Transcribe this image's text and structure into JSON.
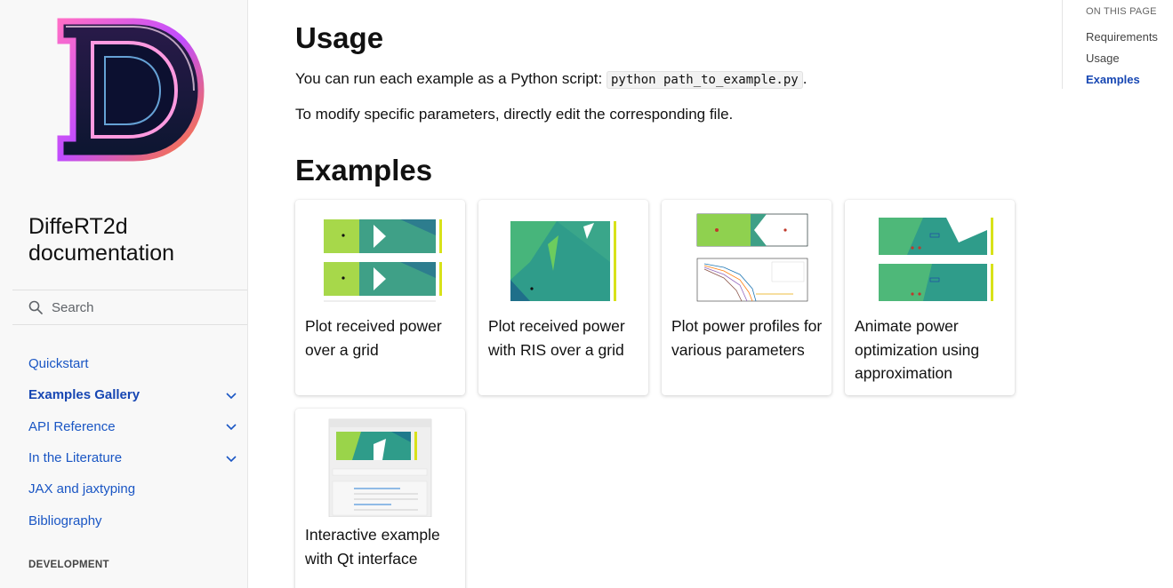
{
  "sidebar": {
    "title": "DiffeRT2d documentation",
    "search_placeholder": "Search",
    "items": [
      {
        "label": "Quickstart"
      },
      {
        "label": "Examples Gallery"
      },
      {
        "label": "API Reference"
      },
      {
        "label": "In the Literature"
      },
      {
        "label": "JAX and jaxtyping"
      },
      {
        "label": "Bibliography"
      }
    ],
    "section_caption": "DEVELOPMENT"
  },
  "main": {
    "usage_heading": "Usage",
    "usage_text": "You can run each example as a Python script:",
    "usage_code": "python path_to_example.py",
    "usage_text_end": ".",
    "modify_text": "To modify specific parameters, directly edit the corresponding file.",
    "examples_heading": "Examples",
    "cards": [
      {
        "caption": "Plot received power over a grid"
      },
      {
        "caption": "Plot received power with RIS over a grid"
      },
      {
        "caption": "Plot power profiles for various parameters"
      },
      {
        "caption": "Animate power optimization using approximation"
      },
      {
        "caption": "Interactive example with Qt interface"
      }
    ]
  },
  "toc": {
    "caption": "ON THIS PAGE",
    "items": [
      {
        "label": "Requirements"
      },
      {
        "label": "Usage"
      },
      {
        "label": "Examples"
      }
    ]
  },
  "colors": {
    "link": "#1a56c4",
    "active_link": "#1747b3",
    "sidebar_bg": "#f8f8f8"
  }
}
